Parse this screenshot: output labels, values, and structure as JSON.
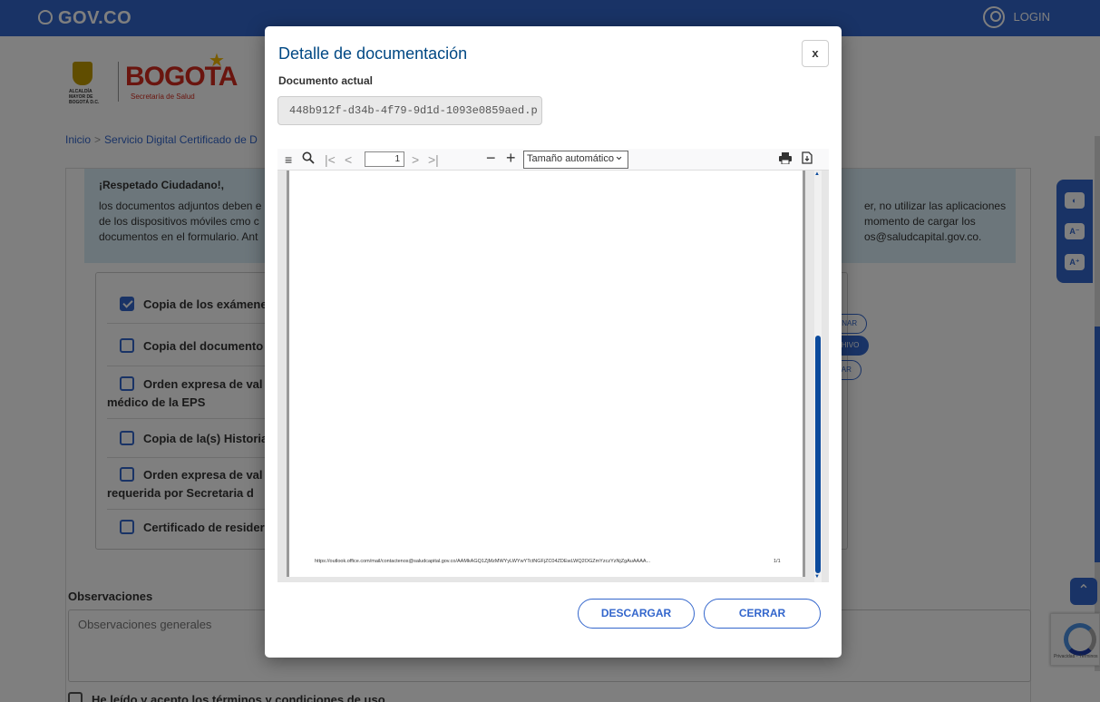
{
  "topbar": {
    "brand": "GOV.CO",
    "login": "LOGIN"
  },
  "logo": {
    "escudo_text": "ALCALDÍA MAYOR DE BOGOTÁ D.C.",
    "bogota": "BOGOTA",
    "subtitle": "Secretaría de Salud"
  },
  "breadcrumb": {
    "home": "Inicio",
    "separator": ">",
    "current": "Servicio Digital Certificado de D"
  },
  "notice": {
    "title": "¡Respetado Ciudadano!,",
    "left_lines": [
      "los documentos adjuntos deben e",
      "de los dispositivos móviles cmo c",
      "documentos en el formulario. Ant"
    ],
    "right_lines": [
      "er, no utilizar las aplicaciones",
      "momento de cargar los",
      "os@saludcapital.gov.co."
    ]
  },
  "checklist": [
    {
      "label": "Copia de los exámene",
      "checked": true
    },
    {
      "label": "Copia del documento",
      "checked": false
    },
    {
      "label": "Orden expresa de val",
      "label2": "médico de la EPS",
      "checked": false
    },
    {
      "label": "Copia de la(s) Historia",
      "checked": false
    },
    {
      "label": "Orden expresa de val",
      "label2": "requerida por Secretaria d",
      "checked": false
    },
    {
      "label": "Certificado de resider",
      "checked": false
    }
  ],
  "side_buttons": [
    "ONAR",
    "CHIVO",
    "RAR"
  ],
  "observaciones": {
    "label": "Observaciones",
    "placeholder": "Observaciones generales"
  },
  "terms": "He leído y acepto los términos y condiciones de uso.",
  "captcha_text": "Privacidad - Términos",
  "modal": {
    "title": "Detalle de documentación",
    "close": "x",
    "doc_label": "Documento actual",
    "doc_value": "448b912f-d34b-4f79-9d1d-1093e0859aed.p",
    "viewer": {
      "page_current": "1",
      "zoom": "Tamaño automático",
      "footer_url": "https://outlook.office.com/mail/contactenos@saludcapital.gov.co/AAMkAGQ1ZjMzMWYyLWYwYTctNGFjZC04ZDEwLWQ2OGZmYzczYzNjZgAuAAAA...",
      "page_count": "1/1"
    },
    "buttons": {
      "download": "DESCARGAR",
      "close": "CERRAR"
    }
  },
  "colors": {
    "primary": "#3366cc",
    "title": "#004884",
    "overlay": "rgba(0,0,0,0.5)"
  }
}
